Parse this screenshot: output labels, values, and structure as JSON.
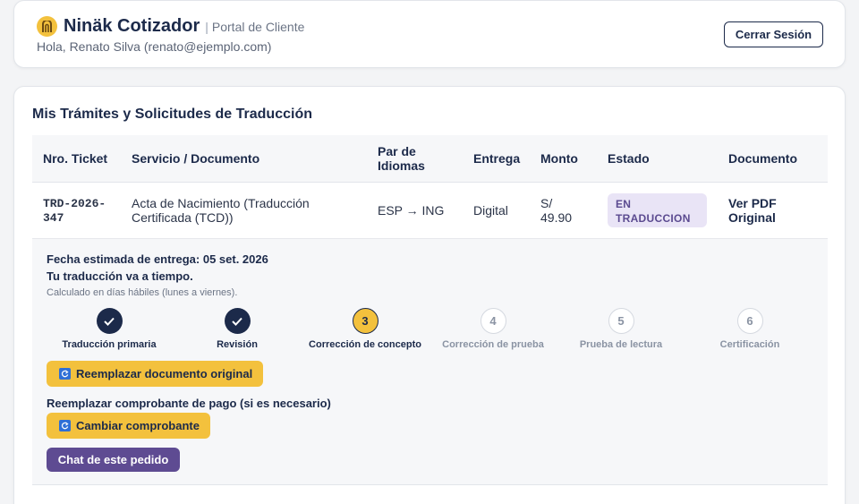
{
  "header": {
    "brand_name": "Ninäk Cotizador",
    "separator": "|",
    "portal_label": "Portal de Cliente",
    "greeting": "Hola, Renato Silva (renato@ejemplo.com)",
    "logout_label": "Cerrar Sesión",
    "logo_icon": "translation-logo-icon",
    "brand_color": "#f3c13d"
  },
  "main": {
    "title": "Mis Trámites y Solicitudes de Traducción",
    "columns": {
      "ticket": "Nro. Ticket",
      "service": "Servicio / Documento",
      "languages_line1": "Par de",
      "languages_line2": "Idiomas",
      "delivery": "Entrega",
      "amount": "Monto",
      "status": "Estado",
      "document": "Documento"
    },
    "row": {
      "ticket_line1": "TRD-2026-",
      "ticket_line2": "347",
      "service_line1": "Acta de Nacimiento (Traducción",
      "service_line2": "Certificada (TCD))",
      "languages": "ESP → ING",
      "delivery": "Digital",
      "amount_line1": "S/",
      "amount_line2": "49.90",
      "status_line1": "EN",
      "status_line2": "TRADUCCION",
      "document_line1": "Ver PDF",
      "document_line2": "Original"
    },
    "detail": {
      "estimated_date": "Fecha estimada de entrega: 05 set. 2026",
      "on_time": "Tu traducción va a tiempo.",
      "note": "Calculado en días hábiles (lunes a viernes).",
      "steps": [
        {
          "number": "1",
          "label": "Traducción primaria",
          "state": "done"
        },
        {
          "number": "2",
          "label": "Revisión",
          "state": "done"
        },
        {
          "number": "3",
          "label": "Corrección de concepto",
          "state": "current"
        },
        {
          "number": "4",
          "label": "Corrección de prueba",
          "state": "pending"
        },
        {
          "number": "5",
          "label": "Prueba de lectura",
          "state": "pending"
        },
        {
          "number": "6",
          "label": "Certificación",
          "state": "pending"
        }
      ],
      "replace_document_button": "Reemplazar documento original",
      "replace_payment_label": "Reemplazar comprobante de pago (si es necesario)",
      "change_receipt_button": "Cambiar comprobante",
      "chat_button": "Chat de este pedido"
    }
  }
}
